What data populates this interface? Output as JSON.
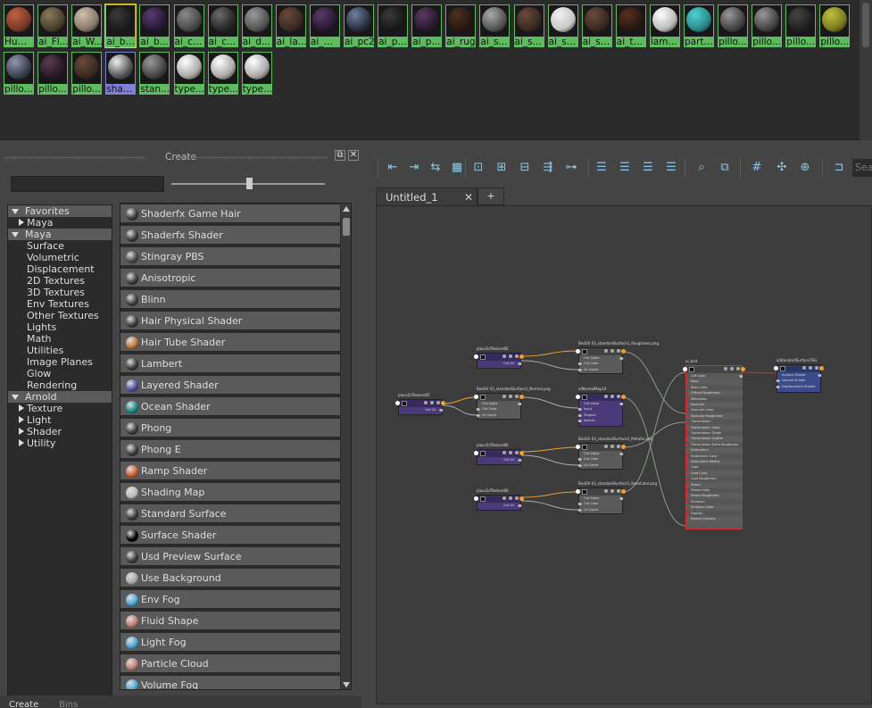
{
  "swatch_bin": {
    "swatches": [
      {
        "label": "Hum...",
        "color": "#7a3a26",
        "hi": "#c06040"
      },
      {
        "label": "ai_Fl...",
        "color": "#4a4030",
        "hi": "#8a7a5a"
      },
      {
        "label": "ai_W...",
        "color": "#8a7a6a",
        "hi": "#d0c0b0"
      },
      {
        "label": "ai_bed",
        "color": "#1c1c1c",
        "hi": "#3a3a3a",
        "selected": true
      },
      {
        "label": "ai_b...",
        "color": "#2a1a38",
        "hi": "#5a3a70"
      },
      {
        "label": "ai_cart",
        "color": "#4a4a4a",
        "hi": "#8a8a8a"
      },
      {
        "label": "ai_c...",
        "color": "#2a2a2a",
        "hi": "#6a6a6a"
      },
      {
        "label": "ai_d...",
        "color": "#555",
        "hi": "#999"
      },
      {
        "label": "ai_la...",
        "color": "#3a2a22",
        "hi": "#6a4a3a"
      },
      {
        "label": "ai_m...",
        "color": "#2a1a34",
        "hi": "#5a3a6a"
      },
      {
        "label": "ai_pc2",
        "color": "#2a3040",
        "hi": "#7080a0"
      },
      {
        "label": "ai_pi...",
        "color": "#1a1a1a",
        "hi": "#3a3a3a"
      },
      {
        "label": "ai_p...",
        "color": "#2a1a30",
        "hi": "#5a3a60"
      },
      {
        "label": "ai_rug",
        "color": "#2a1a12",
        "hi": "#4a3020"
      },
      {
        "label": "ai_s...",
        "color": "#555",
        "hi": "#aaa"
      },
      {
        "label": "ai_s...",
        "color": "#3a2a22",
        "hi": "#6a4a3a"
      },
      {
        "label": "ai_st...",
        "color": "#c8c8c8",
        "hi": "#f0f0f0"
      },
      {
        "label": "ai_st...",
        "color": "#3a2a22",
        "hi": "#6a4a3a"
      },
      {
        "label": "ai_ta...",
        "color": "#2a1812",
        "hi": "#5a3020"
      },
      {
        "label": "lamb...",
        "color": "#bbb",
        "hi": "#fff"
      },
      {
        "label": "parti...",
        "color": "#2a8a8a",
        "hi": "#50d0d0"
      },
      {
        "label": "pillo...",
        "color": "#444",
        "hi": "#999"
      },
      {
        "label": "pillo...",
        "color": "#444",
        "hi": "#999"
      },
      {
        "label": "pillo...",
        "color": "#222",
        "hi": "#444"
      },
      {
        "label": "pillo...",
        "color": "#7a7a20",
        "hi": "#c0c040"
      },
      {
        "label": "pillo...",
        "color": "#3a4050",
        "hi": "#9098b0"
      },
      {
        "label": "pillo...",
        "color": "#2a1a28",
        "hi": "#5a3a50"
      },
      {
        "label": "pillo...",
        "color": "#3a2a22",
        "hi": "#6a4a3a"
      },
      {
        "label": "shad...",
        "color": "#555",
        "hi": "#eee",
        "selected2": true
      },
      {
        "label": "stan...",
        "color": "#444",
        "hi": "#999"
      },
      {
        "label": "type...",
        "color": "#aaa",
        "hi": "#fff"
      },
      {
        "label": "type...",
        "color": "#aaa",
        "hi": "#fff"
      },
      {
        "label": "type...",
        "color": "#aaa",
        "hi": "#fff"
      }
    ]
  },
  "create_panel": {
    "title": "Create",
    "tree": [
      {
        "label": "Favorites",
        "kind": "hdr",
        "state": "d"
      },
      {
        "label": "Maya",
        "kind": "sub",
        "state": "r"
      },
      {
        "label": "Maya",
        "kind": "hdr",
        "state": "d"
      },
      {
        "label": "Surface",
        "kind": "item"
      },
      {
        "label": "Volumetric",
        "kind": "item"
      },
      {
        "label": "Displacement",
        "kind": "item"
      },
      {
        "label": "2D Textures",
        "kind": "item"
      },
      {
        "label": "3D Textures",
        "kind": "item"
      },
      {
        "label": "Env Textures",
        "kind": "item"
      },
      {
        "label": "Other Textures",
        "kind": "item"
      },
      {
        "label": "Lights",
        "kind": "item"
      },
      {
        "label": "Math",
        "kind": "item"
      },
      {
        "label": "Utilities",
        "kind": "item"
      },
      {
        "label": "Image Planes",
        "kind": "item"
      },
      {
        "label": "Glow",
        "kind": "item"
      },
      {
        "label": "Rendering",
        "kind": "item"
      },
      {
        "label": "Arnold",
        "kind": "hdr",
        "state": "d"
      },
      {
        "label": "Texture",
        "kind": "sub",
        "state": "r"
      },
      {
        "label": "Light",
        "kind": "sub",
        "state": "r"
      },
      {
        "label": "Shader",
        "kind": "sub",
        "state": "r"
      },
      {
        "label": "Utility",
        "kind": "sub",
        "state": "r"
      }
    ],
    "nodes": [
      {
        "label": "Shaderfx Game Hair",
        "icon": "#3a3a3a"
      },
      {
        "label": "Shaderfx Shader",
        "icon": "#3a3a3a"
      },
      {
        "label": "Stingray PBS",
        "icon": "#4a4a4a"
      },
      {
        "label": "Anisotropic",
        "icon": "#3a3a3a"
      },
      {
        "label": "Blinn",
        "icon": "#3a3a3a"
      },
      {
        "label": "Hair Physical Shader",
        "icon": "#3a3a3a"
      },
      {
        "label": "Hair Tube Shader",
        "icon": "#c07840"
      },
      {
        "label": "Lambert",
        "icon": "#3a3a3a"
      },
      {
        "label": "Layered Shader",
        "icon": "#5050a0"
      },
      {
        "label": "Ocean Shader",
        "icon": "#1a8a8a"
      },
      {
        "label": "Phong",
        "icon": "#3a3a3a"
      },
      {
        "label": "Phong E",
        "icon": "#3a3a3a"
      },
      {
        "label": "Ramp Shader",
        "icon": "#d06030"
      },
      {
        "label": "Shading Map",
        "icon": "#bbb"
      },
      {
        "label": "Standard Surface",
        "icon": "#3a3a3a"
      },
      {
        "label": "Surface Shader",
        "icon": "#000"
      },
      {
        "label": "Usd Preview Surface",
        "icon": "#3a3a3a"
      },
      {
        "label": "Use Background",
        "icon": "#aaa"
      },
      {
        "label": "Env Fog",
        "icon": "#4aa8d8"
      },
      {
        "label": "Fluid Shape",
        "icon": "#c08070"
      },
      {
        "label": "Light Fog",
        "icon": "#4aa8d8"
      },
      {
        "label": "Particle Cloud",
        "icon": "#c08070"
      },
      {
        "label": "Volume Fog",
        "icon": "#4aa8d8"
      }
    ],
    "bottom_tabs": [
      "Create",
      "Bins"
    ]
  },
  "editor": {
    "tab_label": "Untitled_1",
    "tab_close": "✕",
    "tab_add": "+",
    "search_placeholder": "Sea",
    "toolbar_icons": [
      "input-connections-icon",
      "output-connections-icon",
      "input-output-icon",
      "graph-icon",
      "frame-all-icon",
      "frame-selected-icon",
      "reset-icon",
      "pin-icon",
      "layout-icon",
      "hide-attrs-icon",
      "show-connected-icon",
      "show-all-icon",
      "custom-view-icon",
      "search-icon",
      "snapshot-icon",
      "grid-icon",
      "snap-icon",
      "add-node-icon",
      "toggle-layout-icon"
    ],
    "nodes": [
      {
        "id": "p2t_rough",
        "title": "place2dTexture66",
        "row": "Out UV",
        "color": "#4a3a7a"
      },
      {
        "id": "p2t_main",
        "title": "place2dTexture65",
        "row": "Out UV",
        "color": "#4a3a7a"
      },
      {
        "id": "p2t_metal",
        "title": "place2dTexture66",
        "row": "Out UV",
        "color": "#4a3a7a"
      },
      {
        "id": "p2t_base",
        "title": "place2dTexture66",
        "row": "Out UV",
        "color": "#4a3a7a"
      },
      {
        "id": "f_rough",
        "title": "BedUV 03_standardSurface1_Roughness.png",
        "rows": [
          "Out Alpha",
          "Out Color",
          "Uv Coord"
        ]
      },
      {
        "id": "f_normal",
        "title": "BedUV 03_standardSurface1_Normal.png",
        "rows": [
          "Out Alpha",
          "Out Color",
          "Uv Coord"
        ]
      },
      {
        "id": "normalmap",
        "title": "aiNormalMap14",
        "rows": [
          "Out Value",
          "Input",
          "Tangent",
          "Normal"
        ]
      },
      {
        "id": "f_metal",
        "title": "BedUV 03_standardSurface1_Metallic.png",
        "rows": [
          "Out Alpha",
          "Out Color",
          "Uv Coord"
        ]
      },
      {
        "id": "f_base",
        "title": "BedUV 03_standardSurface1_BaseColor.png",
        "rows": [
          "Out Alpha",
          "Out Color",
          "Uv Coord"
        ]
      },
      {
        "id": "ai_bed",
        "title": "ai_bed",
        "rows": [
          "Out Color",
          "Base",
          "Base Color",
          "Diffuse Roughness",
          "Metalness",
          "Specular",
          "Specular Color",
          "Specular Roughness",
          "Transmission",
          "Transmission Color",
          "Transmission Depth",
          "Transmission Scatter",
          "Transmission Extra Roughness",
          "Subsurface",
          "Subsurface Color",
          "Subsurface Radius",
          "Coat",
          "Coat Color",
          "Coat Roughness",
          "Sheen",
          "Sheen Color",
          "Sheen Roughness",
          "Emission",
          "Emission Color",
          "Opacity",
          "Normal Camera"
        ]
      },
      {
        "id": "sg",
        "title": "aiStandardSurface7SG",
        "rows": [
          "Surface Shader",
          "Volume Shader",
          "Displacement Shader"
        ]
      }
    ]
  }
}
